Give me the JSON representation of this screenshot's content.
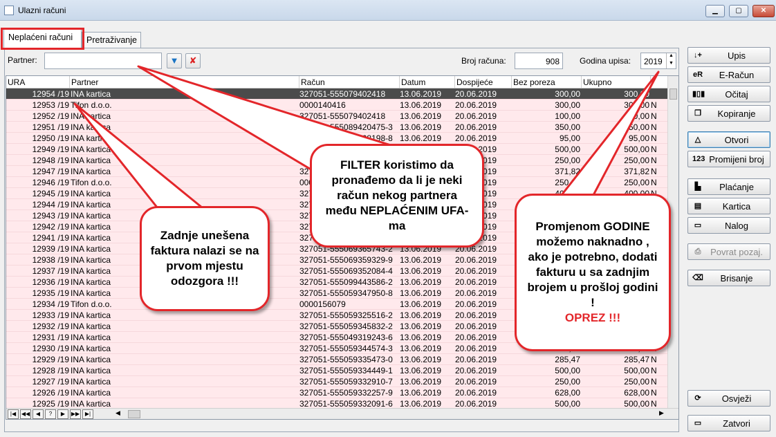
{
  "window": {
    "title": "Ulazni računi"
  },
  "tabs": [
    {
      "label": "Neplaćeni računi",
      "active": true
    },
    {
      "label": "Pretraživanje",
      "active": false
    }
  ],
  "filter": {
    "partner_label": "Partner:",
    "partner_value": "",
    "broj_label": "Broj računa:",
    "broj_value": "908",
    "godina_label": "Godina upisa:",
    "godina_value": "2019"
  },
  "grid": {
    "columns": [
      "URA",
      "Partner",
      "Račun",
      "Datum",
      "Dospijeće",
      "Bez poreza",
      "Ukupno"
    ],
    "rows": [
      [
        "12954 /19",
        "INA kartica",
        "327051-555079402418",
        "13.06.2019",
        "20.06.2019",
        "300,00",
        "300,00",
        ""
      ],
      [
        "12953 /19",
        "Tifon d.o.o.",
        "0000140416",
        "13.06.2019",
        "20.06.2019",
        "300,00",
        "300,00",
        "N"
      ],
      [
        "12952 /19",
        "INA kartica",
        "327051-555079402418",
        "13.06.2019",
        "20.06.2019",
        "100,00",
        "100,00",
        "N"
      ],
      [
        "12951 /19",
        "INA kartica",
        "327051-555089420475-3",
        "13.06.2019",
        "20.06.2019",
        "350,00",
        "350,00",
        "N"
      ],
      [
        "12950 /19",
        "INA kartica",
        " 327051-555089408198-8",
        "13.06.2019",
        "20.06.2019",
        "95,00",
        "95,00",
        "N"
      ],
      [
        "12949 /19",
        "INA kartica",
        "327051-555089400000-1",
        "13.06.2019",
        "20.06.2019",
        "500,00",
        "500,00",
        "N"
      ],
      [
        "12948 /19",
        "INA kartica",
        "327051-555089400000-2",
        "13.06.2019",
        "20.06.2019",
        "250,00",
        "250,00",
        "N"
      ],
      [
        "12947 /19",
        "INA kartica",
        "327051-555089400000-3",
        "13.06.2019",
        "20.06.2019",
        "371,82",
        "371,82",
        "N"
      ],
      [
        "12946 /19",
        "Tifon d.o.o.",
        "0000156000",
        "13.06.2019",
        "20.06.2019",
        "250,00",
        "250,00",
        "N"
      ],
      [
        "12945 /19",
        "INA kartica",
        "327051-555069400000-4",
        "13.06.2019",
        "20.06.2019",
        "400,00",
        "400,00",
        "N"
      ],
      [
        "12944 /19",
        "INA kartica",
        "327051-555069400000-5",
        "13.06.2019",
        "20.06.2019",
        "300,00",
        "300,00",
        "N"
      ],
      [
        "12943 /19",
        "INA kartica",
        "327051-555069400000-6",
        "13.06.2019",
        "20.06.2019",
        "200,00",
        "200,00",
        "N"
      ],
      [
        "12942 /19",
        "INA kartica",
        "327051-555069400000-7",
        "13.06.2019",
        "20.06.2019",
        "150,00",
        "150,00",
        "N"
      ],
      [
        "12941 /19",
        "INA kartica",
        "327051-555069400000-8",
        "13.06.2019",
        "20.06.2019",
        "100,00",
        "100,00",
        "N"
      ],
      [
        "12939 /19",
        "INA kartica",
        "327051-555069365743-2",
        "13.06.2019",
        "20.06.2019",
        "500,00",
        "500,00",
        "N"
      ],
      [
        "12938 /19",
        "INA kartica",
        "327051-555069359329-9",
        "13.06.2019",
        "20.06.2019",
        "250,00",
        "250,00",
        "N"
      ],
      [
        "12937 /19",
        "INA kartica",
        "327051-555069352084-4",
        "13.06.2019",
        "20.06.2019",
        "300,00",
        "300,00",
        "N"
      ],
      [
        "12936 /19",
        "INA kartica",
        "327051-555099443586-2",
        "13.06.2019",
        "20.06.2019",
        "350,00",
        "350,00",
        "N"
      ],
      [
        "12935 /19",
        "INA kartica",
        "327051-555059347950-8",
        "13.06.2019",
        "20.06.2019",
        "200,00",
        "200,00",
        "N"
      ],
      [
        "12934 /19",
        "Tifon d.o.o.",
        "0000156079",
        "13.06.2019",
        "20.06.2019",
        "250,00",
        "250,00",
        "N"
      ],
      [
        "12933 /19",
        "INA kartica",
        "327051-555059325516-2",
        "13.06.2019",
        "20.06.2019",
        "300,00",
        "300,00",
        "N"
      ],
      [
        "12932 /19",
        "INA kartica",
        "327051-555059345832-2",
        "13.06.2019",
        "20.06.2019",
        "400,00",
        "400,00",
        "N"
      ],
      [
        "12931 /19",
        "INA kartica",
        "327051-555049319243-6",
        "13.06.2019",
        "20.06.2019",
        "150,00",
        "150,00",
        "N"
      ],
      [
        "12930 /19",
        "INA kartica",
        "327051-555059344574-3",
        "13.06.2019",
        "20.06.2019",
        "250,00",
        "250,00",
        "N"
      ],
      [
        "12929 /19",
        "INA kartica",
        "327051-555059335473-0",
        "13.06.2019",
        "20.06.2019",
        "285,47",
        "285,47",
        "N"
      ],
      [
        "12928 /19",
        "INA kartica",
        "327051-555059334449-1",
        "13.06.2019",
        "20.06.2019",
        "500,00",
        "500,00",
        "N"
      ],
      [
        "12927 /19",
        "INA kartica",
        "327051-555059332910-7",
        "13.06.2019",
        "20.06.2019",
        "250,00",
        "250,00",
        "N"
      ],
      [
        "12926 /19",
        "INA kartica",
        "327051-555059332257-9",
        "13.06.2019",
        "20.06.2019",
        "628,00",
        "628,00",
        "N"
      ],
      [
        "12925 /19",
        "INA kartica",
        "327051-555059332091-6",
        "13.06.2019",
        "20.06.2019",
        "500,00",
        "500,00",
        "N"
      ],
      [
        "12924 /19",
        "INA kartica",
        "327051-555079376850-3",
        "13.06.2019",
        "20.06.2019",
        "500,00",
        "500,00",
        "N"
      ]
    ]
  },
  "side_buttons": [
    {
      "label": "Upis",
      "icon": "↓+",
      "icon_name": "download-plus-icon"
    },
    {
      "label": "E-Račun",
      "icon": "eR",
      "icon_name": "e-racun-icon"
    },
    {
      "label": "Očitaj",
      "icon": "▮▯▮",
      "icon_name": "barcode-icon"
    },
    {
      "label": "Kopiranje",
      "icon": "❐",
      "icon_name": "copy-icon"
    },
    {
      "label": "Otvori",
      "icon": "△",
      "icon_name": "open-icon"
    },
    {
      "label": "Promijeni broj",
      "icon": "123",
      "icon_name": "number-icon"
    },
    {
      "label": "Plaćanje",
      "icon": "▙",
      "icon_name": "payment-icon"
    },
    {
      "label": "Kartica",
      "icon": "▤",
      "icon_name": "card-icon"
    },
    {
      "label": "Nalog",
      "icon": "▭",
      "icon_name": "order-icon"
    },
    {
      "label": "Povrat pozaj.",
      "icon": "⎙",
      "icon_name": "printer-icon"
    },
    {
      "label": "Brisanje",
      "icon": "⌫",
      "icon_name": "eraser-icon"
    },
    {
      "label": "Osvježi",
      "icon": "⟳",
      "icon_name": "refresh-icon"
    },
    {
      "label": "Zatvori",
      "icon": "▭",
      "icon_name": "folder-icon"
    }
  ],
  "callouts": {
    "filter": "FILTER koristimo da pronađemo da li je neki račun nekog partnera među NEPLAĆENIM UFA-ma",
    "first_row": "Zadnje unešena faktura nalazi se na prvom mjestu odozgora !!!",
    "year_text": "Promjenom GODINE možemo naknadno , ako je potrebno, dodati fakturu u sa zadnjim brojem u prošloj godini !",
    "year_warning": "OPREZ !!!"
  },
  "colors": {
    "row_background": "#ffe9ec",
    "selected_row": "#4b4b4b",
    "callout_border": "#e3262a",
    "warning_text": "#e3262a"
  }
}
